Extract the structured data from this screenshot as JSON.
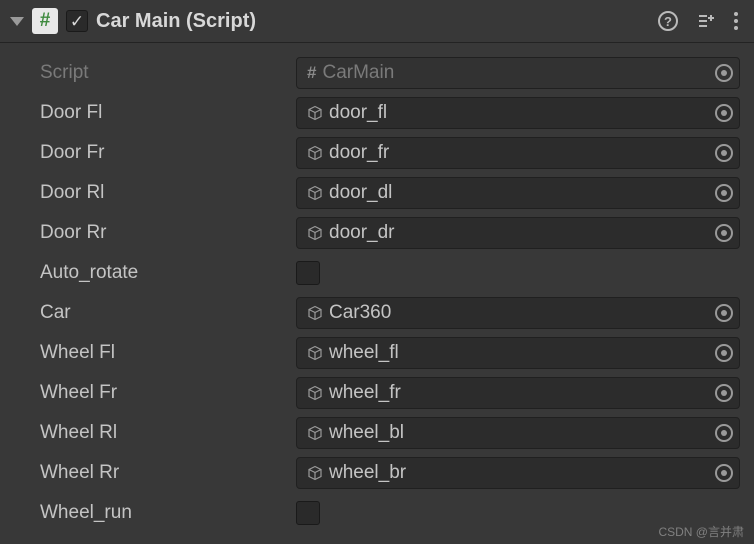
{
  "header": {
    "title": "Car Main (Script)",
    "enabled": true
  },
  "script": {
    "label": "Script",
    "value": "CarMain"
  },
  "properties": [
    {
      "label": "Door Fl",
      "type": "object",
      "value": "door_fl"
    },
    {
      "label": "Door Fr",
      "type": "object",
      "value": "door_fr"
    },
    {
      "label": "Door Rl",
      "type": "object",
      "value": "door_dl"
    },
    {
      "label": "Door Rr",
      "type": "object",
      "value": "door_dr"
    },
    {
      "label": "Auto_rotate",
      "type": "bool",
      "value": false
    },
    {
      "label": "Car",
      "type": "object",
      "value": "Car360"
    },
    {
      "label": "Wheel Fl",
      "type": "object",
      "value": "wheel_fl"
    },
    {
      "label": "Wheel Fr",
      "type": "object",
      "value": "wheel_fr"
    },
    {
      "label": "Wheel Rl",
      "type": "object",
      "value": "wheel_bl"
    },
    {
      "label": "Wheel Rr",
      "type": "object",
      "value": "wheel_br"
    },
    {
      "label": "Wheel_run",
      "type": "bool",
      "value": false
    }
  ],
  "watermark": "CSDN @言并肃"
}
